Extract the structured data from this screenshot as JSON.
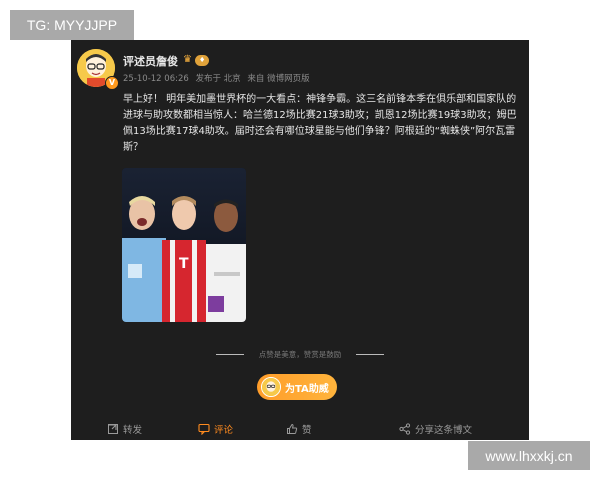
{
  "watermarks": {
    "top_left": "TG: MYYJJPP",
    "bottom_right": "www.lhxxkj.cn"
  },
  "post": {
    "author": "评述员詹俊",
    "meta": {
      "date": "25-10-12 06:26",
      "location": "发布于 北京",
      "source": "来自 微博网页版"
    },
    "text": "早上好！ 明年美加墨世界杯的一大看点：神锋争霸。这三名前锋本季在俱乐部和国家队的进球与助攻数都相当惊人：哈兰德12场比赛21球3助攻；凯恩12场比赛19球3助攻；姆巴佩13场比赛17球4助攻。届时还会有哪位球星能与他们争锋？阿根廷的“蜘蛛侠”阿尔瓦雷斯？",
    "divider_text": "点赞是美意，赞赏是鼓励",
    "support_label": "为TA助威"
  },
  "actions": {
    "repost": "转发",
    "comment": "评论",
    "like": "赞",
    "share": "分享这条博文"
  },
  "colors": {
    "card_bg": "#1e1e1e",
    "accent": "#ff8b1f",
    "watermark_bg": "#a9a9a9"
  }
}
